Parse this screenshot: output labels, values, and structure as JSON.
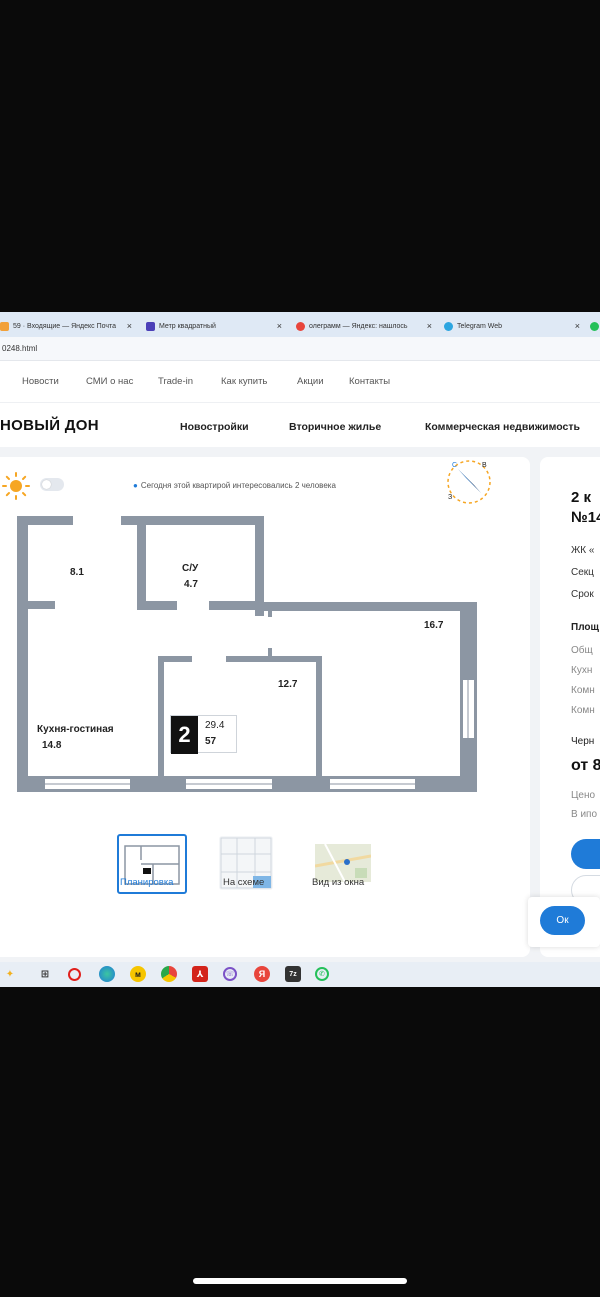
{
  "browser": {
    "tabs": [
      {
        "label": "59 · Входящие — Яндекс Почта",
        "close": "×",
        "color": "#f2a13a"
      },
      {
        "label": "Метр квадратный",
        "close": "×",
        "color": "#4b3fb8"
      },
      {
        "label": "олеграмм — Яндекс: нашлось",
        "close": "×",
        "color": "#e8453c"
      },
      {
        "label": "Telegram Web",
        "close": "×",
        "color": "#2ca5e0"
      }
    ],
    "address": "0248.html"
  },
  "top_nav": [
    "Новости",
    "СМИ о нас",
    "Trade-in",
    "Как купить",
    "Акции",
    "Контакты"
  ],
  "logo_text": "НОВЫЙ ДОН",
  "main_nav": [
    "Новостройки",
    "Вторичное жилье",
    "Коммерческая недвижимость"
  ],
  "interest_text": "Сегодня этой квартирой интересовались 2 человека",
  "compass": {
    "n": "С",
    "e": "В",
    "w": "З"
  },
  "rooms": [
    {
      "label": "",
      "area": "8.1"
    },
    {
      "label": "С/У",
      "area": "4.7"
    },
    {
      "label": "",
      "area": "16.7"
    },
    {
      "label": "",
      "area": "12.7"
    },
    {
      "label": "Кухня-гостиная",
      "area": "14.8"
    }
  ],
  "badge": {
    "rooms": "2",
    "living_area": "29.4",
    "floor": "57"
  },
  "thumb_tabs": [
    "Планировка",
    "На схеме",
    "Вид из окна"
  ],
  "right_panel": {
    "title_1": "2 к",
    "title_2": "№14",
    "lines_1": [
      "ЖК «",
      "Секц",
      "Срок"
    ],
    "section_label": "Площ",
    "lines_2": [
      "Общ",
      "Кухн",
      "Комн",
      "Комн"
    ],
    "finish_label": "Черн",
    "price": "от 8",
    "price_note_1": "Цено",
    "price_note_2": "В ипо"
  },
  "ok_button": "Ок",
  "colors": {
    "accent": "#1f7bd8",
    "wall": "#8c96a3",
    "sun": "#f6a623"
  }
}
